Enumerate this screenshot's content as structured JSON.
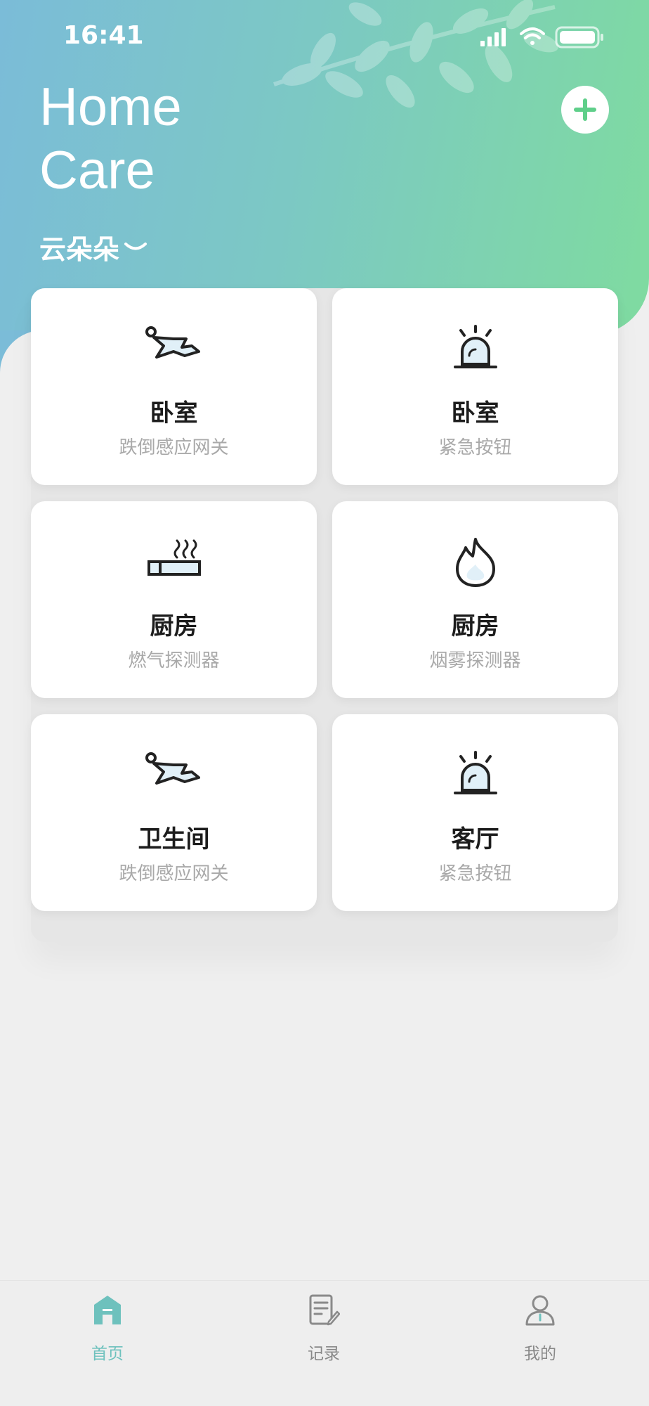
{
  "status_bar": {
    "time": "16:41"
  },
  "header": {
    "title_line1": "Home",
    "title_line2": "Care",
    "family_name": "云朵朵"
  },
  "colors": {
    "accent": "#6ec1bd",
    "hero_left": "#7bbcd8",
    "hero_right": "#7fdba0"
  },
  "devices": [
    {
      "room": "卧室",
      "type": "跌倒感应网关",
      "icon": "fall-person-icon"
    },
    {
      "room": "卧室",
      "type": "紧急按钮",
      "icon": "alarm-light-icon"
    },
    {
      "room": "厨房",
      "type": "燃气探测器",
      "icon": "cigarette-smoke-icon"
    },
    {
      "room": "厨房",
      "type": "烟雾探测器",
      "icon": "flame-icon"
    },
    {
      "room": "卫生间",
      "type": "跌倒感应网关",
      "icon": "fall-person-icon"
    },
    {
      "room": "客厅",
      "type": "紧急按钮",
      "icon": "alarm-light-icon"
    }
  ],
  "tabs": [
    {
      "label": "首页",
      "icon": "home-icon",
      "active": true
    },
    {
      "label": "记录",
      "icon": "record-icon",
      "active": false
    },
    {
      "label": "我的",
      "icon": "profile-icon",
      "active": false
    }
  ]
}
